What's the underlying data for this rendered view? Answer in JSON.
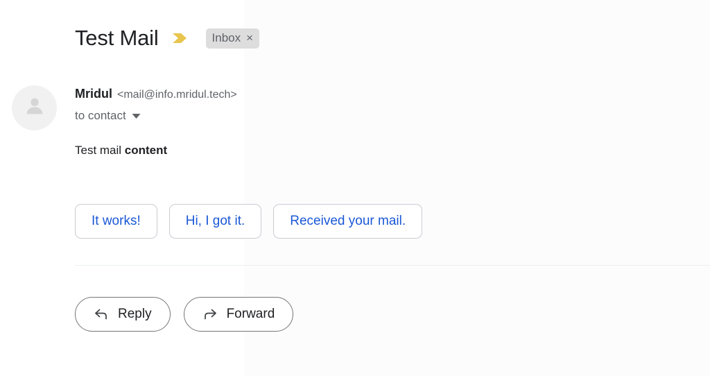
{
  "colors": {
    "background": "#ffffff",
    "text_primary": "#202124",
    "text_secondary": "#5f6368",
    "smart_reply_blue": "#1a58d6",
    "important_marker_yellow": "#e8c54d",
    "label_chip_bg": "#ddddde",
    "avatar_bg": "#f1f1f1",
    "button_border": "#747775",
    "divider": "#eceef0"
  },
  "header": {
    "subject": "Test Mail",
    "important_marker_icon": "important-marker-icon",
    "label": {
      "name": "Inbox",
      "close_glyph": "×"
    }
  },
  "sender": {
    "avatar_icon": "person-avatar-icon",
    "name": "Mridul",
    "email": "<mail@info.mridul.tech>",
    "recipient": "to contact",
    "caret_icon": "chevron-down-icon"
  },
  "body": {
    "text_plain": "Test mail ",
    "text_bold": "content"
  },
  "smart_replies": {
    "items": [
      {
        "label": "It works!"
      },
      {
        "label": "Hi, I got it."
      },
      {
        "label": "Received your mail."
      }
    ]
  },
  "actions": {
    "items": [
      {
        "label": "Reply",
        "icon": "reply-arrow-icon"
      },
      {
        "label": "Forward",
        "icon": "forward-arrow-icon"
      }
    ]
  }
}
